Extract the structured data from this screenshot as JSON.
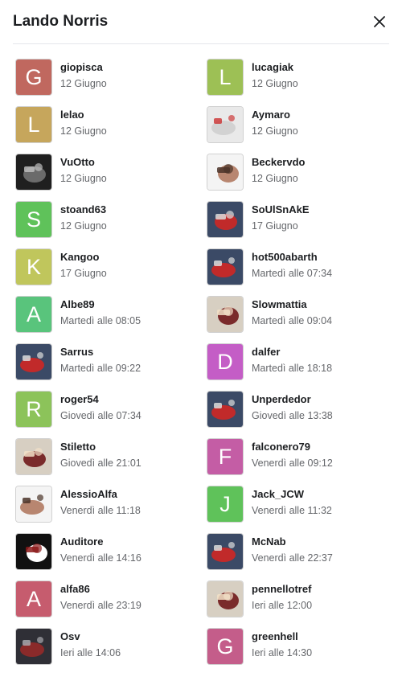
{
  "dialog": {
    "title": "Lando Norris"
  },
  "colors": {
    "title": "#1c1e21",
    "secondary_text": "#65676b",
    "divider": "#e4e6eb"
  },
  "users": [
    {
      "name": "giopisca",
      "date": "12 Giugno",
      "letter": "G",
      "color": "#c0685f"
    },
    {
      "name": "lucagiak",
      "date": "12 Giugno",
      "letter": "L",
      "color": "#9dc055"
    },
    {
      "name": "lelao",
      "date": "12 Giugno",
      "letter": "L",
      "color": "#c6a65c"
    },
    {
      "name": "Aymaro",
      "date": "12 Giugno",
      "icon": "placeholder-photo"
    },
    {
      "name": "VuOtto",
      "date": "12 Giugno",
      "icon": "car-logo-photo"
    },
    {
      "name": "Beckervdo",
      "date": "12 Giugno",
      "icon": "person-photo"
    },
    {
      "name": "stoand63",
      "date": "12 Giugno",
      "letter": "S",
      "color": "#5fc25a"
    },
    {
      "name": "SoUlSnAkE",
      "date": "17 Giugno",
      "icon": "car-photo"
    },
    {
      "name": "Kangoo",
      "date": "17 Giugno",
      "letter": "K",
      "color": "#c0c65c"
    },
    {
      "name": "hot500abarth",
      "date": "Martedì alle 07:34",
      "icon": "car-photo"
    },
    {
      "name": "Albe89",
      "date": "Martedì alle 08:05",
      "letter": "A",
      "color": "#59c47c"
    },
    {
      "name": "Slowmattia",
      "date": "Martedì alle 09:04",
      "icon": "cartoon-photo"
    },
    {
      "name": "Sarrus",
      "date": "Martedì alle 09:22",
      "icon": "car-photo"
    },
    {
      "name": "dalfer",
      "date": "Martedì alle 18:18",
      "letter": "D",
      "color": "#c45dc6"
    },
    {
      "name": "roger54",
      "date": "Giovedì alle 07:34",
      "letter": "R",
      "color": "#8cc35a"
    },
    {
      "name": "Unperdedor",
      "date": "Giovedì alle 13:38",
      "icon": "car-photo"
    },
    {
      "name": "Stiletto",
      "date": "Giovedì alle 21:01",
      "icon": "cartoon-photo"
    },
    {
      "name": "falconero79",
      "date": "Venerdì alle 09:12",
      "letter": "F",
      "color": "#c45da5"
    },
    {
      "name": "AlessioAlfa",
      "date": "Venerdì alle 11:18",
      "icon": "person-photo"
    },
    {
      "name": "Jack_JCW",
      "date": "Venerdì alle 11:32",
      "letter": "J",
      "color": "#5fc25a"
    },
    {
      "name": "Auditore",
      "date": "Venerdì alle 14:16",
      "icon": "logo-photo"
    },
    {
      "name": "McNab",
      "date": "Venerdì alle 22:37",
      "icon": "car-photo"
    },
    {
      "name": "alfa86",
      "date": "Venerdì alle 23:19",
      "letter": "A",
      "color": "#c65c6e"
    },
    {
      "name": "pennellotref",
      "date": "Ieri alle 12:00",
      "icon": "cartoon-photo"
    },
    {
      "name": "Osv",
      "date": "Ieri alle 14:06",
      "icon": "engine-photo"
    },
    {
      "name": "greenhell",
      "date": "Ieri alle 14:30",
      "letter": "G",
      "color": "#c45d8a"
    }
  ]
}
